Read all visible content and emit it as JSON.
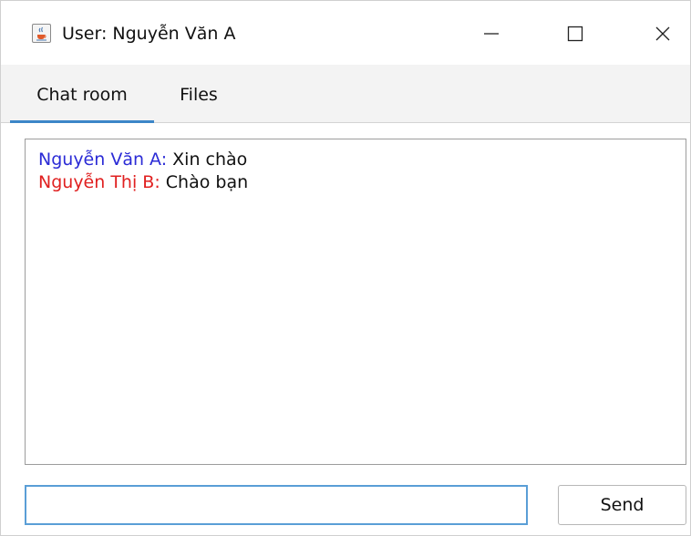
{
  "window": {
    "title": "User: Nguyễn Văn A",
    "icon": "java-cup-icon"
  },
  "controls": {
    "minimize": "minimize-icon",
    "maximize": "maximize-icon",
    "close": "close-icon"
  },
  "tabs": [
    {
      "label": "Chat room",
      "selected": true
    },
    {
      "label": "Files",
      "selected": false
    }
  ],
  "colors": {
    "sender_a": "#2b2bd6",
    "sender_b": "#e02020",
    "tab_underline": "#3c86c8",
    "input_focus_border": "#5a9ed6"
  },
  "messages": [
    {
      "sender": "Nguyễn Văn A:",
      "text": " Xin chào"
    },
    {
      "sender": "Nguyễn Thị B:",
      "text": " Chào bạn"
    }
  ],
  "composer": {
    "value": "",
    "send_label": "Send"
  }
}
